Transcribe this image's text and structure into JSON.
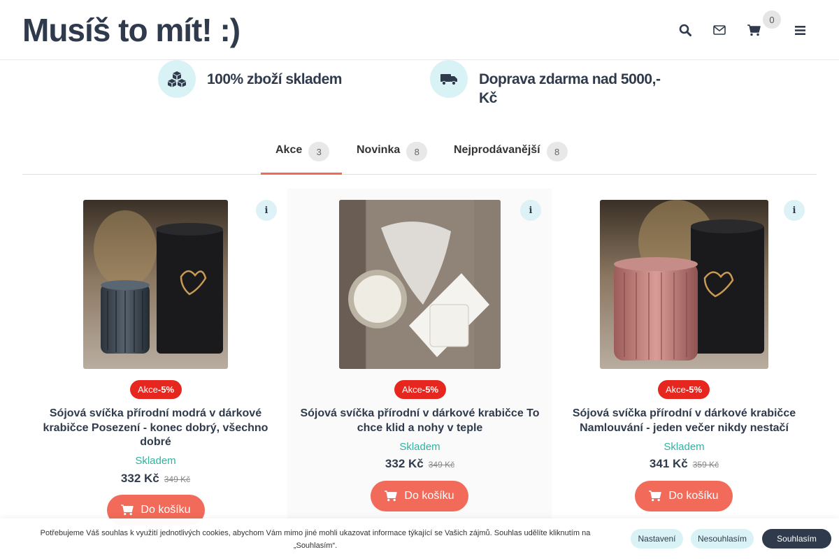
{
  "header": {
    "logo_text": "Musíš to mít! :)",
    "cart_count": "0",
    "icons": [
      "search-icon",
      "envelope-icon",
      "cart-icon",
      "menu-icon"
    ]
  },
  "features": [
    {
      "icon": "cubes-icon",
      "text": "100% zboží skladem"
    },
    {
      "icon": "truck-icon",
      "text": "Doprava zdarma nad 5000,- Kč"
    }
  ],
  "tabs": [
    {
      "label": "Akce",
      "count": "3",
      "active": true
    },
    {
      "label": "Novinka",
      "count": "8",
      "active": false
    },
    {
      "label": "Nejprodávanější",
      "count": "8",
      "active": false
    }
  ],
  "products": [
    {
      "badge_prefix": "Akce",
      "badge_value": "-5%",
      "title": "Sójová svíčka přírodní modrá v dárkové krabičce Posezení - konec dobrý, všechno dobré",
      "stock": "Skladem",
      "price": "332 Kč",
      "old_price": "349 Kč",
      "button": "Do košíku",
      "image_colors": {
        "bg": "#6b5a48",
        "jar": "#3d4650",
        "box": "#1b1b1d"
      }
    },
    {
      "badge_prefix": "Akce",
      "badge_value": "-5%",
      "title": "Sójová svíčka přírodní v dárkové krabičce To chce klid a nohy v teple",
      "stock": "Skladem",
      "price": "332 Kč",
      "old_price": "349 Kč",
      "button": "Do košíku",
      "image_colors": {
        "bg": "#8a7d72",
        "jar": "#e8e4dc",
        "box": "#f2f0ec"
      }
    },
    {
      "badge_prefix": "Akce",
      "badge_value": "-5%",
      "title": "Sójová svíčka přírodní v dárkové krabičce Namlouvání - jeden večer nikdy nestačí",
      "stock": "Skladem",
      "price": "341 Kč",
      "old_price": "359 Kč",
      "button": "Do košíku",
      "image_colors": {
        "bg": "#6b5a48",
        "jar": "#c98a86",
        "box": "#1b1b1d"
      }
    }
  ],
  "cookie": {
    "text": "Potřebujeme Váš souhlas k využití jednotlivých cookies, abychom Vám mimo jiné mohli ukazovat informace týkající se Vašich zájmů. Souhlas udělíte kliknutím na „Souhlasím“.",
    "settings": "Nastavení",
    "disagree": "Nesouhlasím",
    "agree": "Souhlasím"
  },
  "colors": {
    "accent": "#f26a59",
    "sale_badge": "#e5271f",
    "stock": "#2bb5a0",
    "dark": "#2f3b4c",
    "light_teal": "#d9f2f5"
  }
}
